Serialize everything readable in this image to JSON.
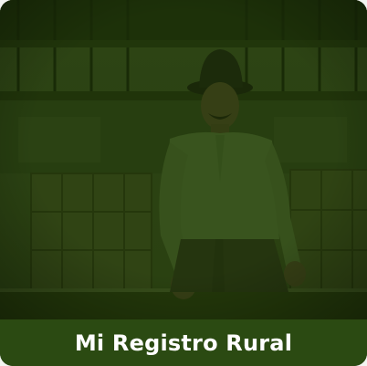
{
  "card": {
    "title": "Mi Registro Rural",
    "image_subject": "farmer-sitting-in-warehouse-photo"
  },
  "colors": {
    "overlay": "#22380c",
    "caption_background": "#2b4a12",
    "caption_text": "#ffffff",
    "frame": "#1f2a10"
  }
}
